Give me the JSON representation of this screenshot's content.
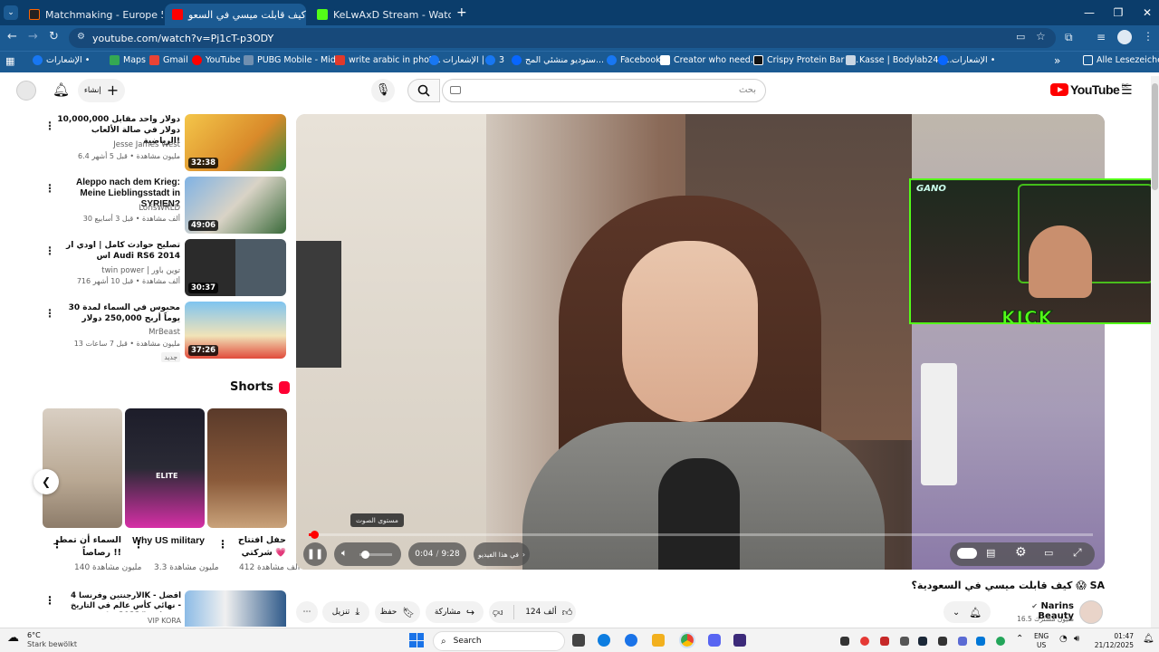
{
  "browser": {
    "tabs": [
      {
        "label": "Matchmaking - Europe 5v5 Qu",
        "active": false,
        "icon": "faceit-icon"
      },
      {
        "label": "كيف قابلت ميسي في السعو",
        "active": true,
        "icon": "youtube-icon"
      },
      {
        "label": "KeLwAxD Stream - Watch Live o",
        "active": false,
        "icon": "kick-icon"
      }
    ],
    "url": "youtube.com/watch?v=Pj1cT-p3ODY",
    "bookmarks": [
      {
        "label": "الإشعارات •",
        "icon": "facebook-icon"
      },
      {
        "label": "Maps",
        "icon": "maps-icon"
      },
      {
        "label": "Gmail",
        "icon": "gmail-icon"
      },
      {
        "label": "YouTube",
        "icon": "youtube-icon"
      },
      {
        "label": "PUBG Mobile - Mid...",
        "icon": "pubg-icon"
      },
      {
        "label": "write arabic in phot...",
        "icon": "write-icon"
      },
      {
        "label": "الإشعارات |",
        "icon": "facebook-icon"
      },
      {
        "label": "3",
        "icon": "facebook-icon"
      },
      {
        "label": "ستوديو منشئي المح...",
        "icon": "meta-icon"
      },
      {
        "label": "Facebook",
        "icon": "facebook-icon"
      },
      {
        "label": "Creator who need...",
        "icon": "creator-icon"
      },
      {
        "label": "Crispy Protein Bar (...",
        "icon": "b-icon"
      },
      {
        "label": "Kasse | Bodylab24 S...",
        "icon": "bodylab-icon"
      },
      {
        "label": "الإشعارات •",
        "icon": "meta-icon"
      }
    ],
    "bookmarks_more": "»",
    "all_bookmarks": "Alle Lesezeichen"
  },
  "youtube": {
    "logo_text": "YouTube",
    "logo_region": "DE",
    "search_placeholder": "بحث",
    "create_label": "إنشاء",
    "related": [
      {
        "title": "دولار واحد مقابل 10,000,000 دولار في صالة الألعاب الرياضية!",
        "channel": "Jesse James West",
        "meta": "6.4 مليون مشاهدة • قبل 5 أشهر",
        "duration": "32:38"
      },
      {
        "title": "Aleppo nach dem Krieg: Meine Lieblingsstadt in SYRIEN?",
        "channel": "LorisWRLD",
        "meta": "30 ألف مشاهدة • قبل 3 أسابيع",
        "duration": "49:06"
      },
      {
        "title": "تصليح حوادث كامل | اودي ار اس Audi RS6 2014",
        "channel": "twin power | توين باور",
        "meta": "716 ألف مشاهدة • قبل 10 أشهر",
        "duration": "30:37"
      },
      {
        "title": "محبوس في السماء لمدة 30 يوماً أربح 250,000 دولار",
        "channel": "MrBeast",
        "meta": "13 مليون مشاهدة • قبل 7 ساعات",
        "badge": "جديد",
        "duration": "37:26"
      }
    ],
    "shorts_heading": "Shorts",
    "shorts": [
      {
        "title": "السماء أن تمطر رصاصاً !!",
        "views": "140 مليون مشاهدة"
      },
      {
        "title": "Why US military",
        "views": "3.3 مليون مشاهدة"
      },
      {
        "title": "حفل افتتاح شركتي 💗",
        "views": "412 ألف مشاهدة"
      }
    ],
    "next_related": {
      "title": "الأرجنتين وفرنسا 4K - أفضل نهائي كأس عالم في التاريخ - qatar2022# تعليق ...",
      "channel": "VIP KORA"
    },
    "player": {
      "current_time": "0:04",
      "duration": "9:28",
      "chapter_label": "في هذا الفيديو",
      "volume_tooltip": "مستوى الصوت",
      "progress_fraction": 0.007,
      "overlay_name": "GANO",
      "overlay_brand": "KICK"
    },
    "video": {
      "title": "كيف قابلت ميسي في السعودية؟ 😱 SA",
      "channel": "Narins Beauty",
      "subscribers": "16.5 مليون مشترك",
      "likes": "124 ألف",
      "share_label": "مشاركة",
      "save_label": "حفظ",
      "download_label": "تنزيل"
    }
  },
  "taskbar": {
    "weather_temp": "6°C",
    "weather_desc": "Stark bewölkt",
    "search_label": "Search",
    "lang_top": "ENG",
    "lang_bottom": "US",
    "time": "01:47",
    "date": "21/12/2025"
  },
  "colors": {
    "yt_red": "#ff0000",
    "chrome_blue": "#1b5a92",
    "kick_green": "#53fc18"
  }
}
